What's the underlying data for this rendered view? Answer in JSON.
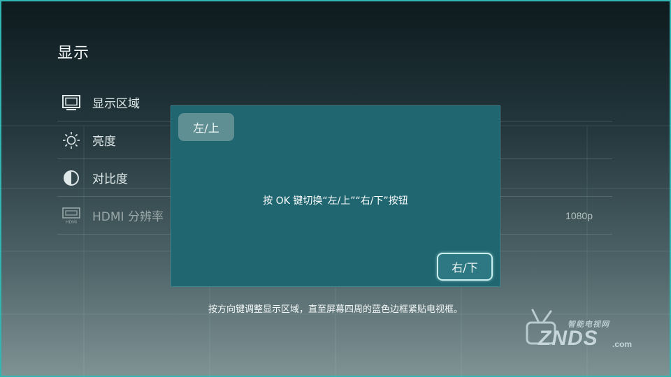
{
  "page": {
    "title": "显示"
  },
  "menu": {
    "items": [
      {
        "label": "显示区域",
        "icon": "display-area-icon",
        "value": ""
      },
      {
        "label": "亮度",
        "icon": "brightness-icon",
        "value": ""
      },
      {
        "label": "对比度",
        "icon": "contrast-icon",
        "value": ""
      },
      {
        "label": "HDMI 分辨率",
        "icon": "hdmi-icon",
        "value": "1080p"
      }
    ]
  },
  "dialog": {
    "left_button": "左/上",
    "message": "按 OK 键切换“左/上”“右/下”按钮",
    "right_button": "右/下"
  },
  "hint": "按方向键调整显示区域，直至屏幕四周的蓝色边框紧贴电视框。",
  "watermark": {
    "top_text": "智能电视网",
    "main_text": "ZNDS",
    "domain_text": ".com"
  },
  "colors": {
    "frame": "#2fb7b0",
    "dialog_bg": "#1f6670",
    "focused_button_border": "#c8eeee"
  }
}
